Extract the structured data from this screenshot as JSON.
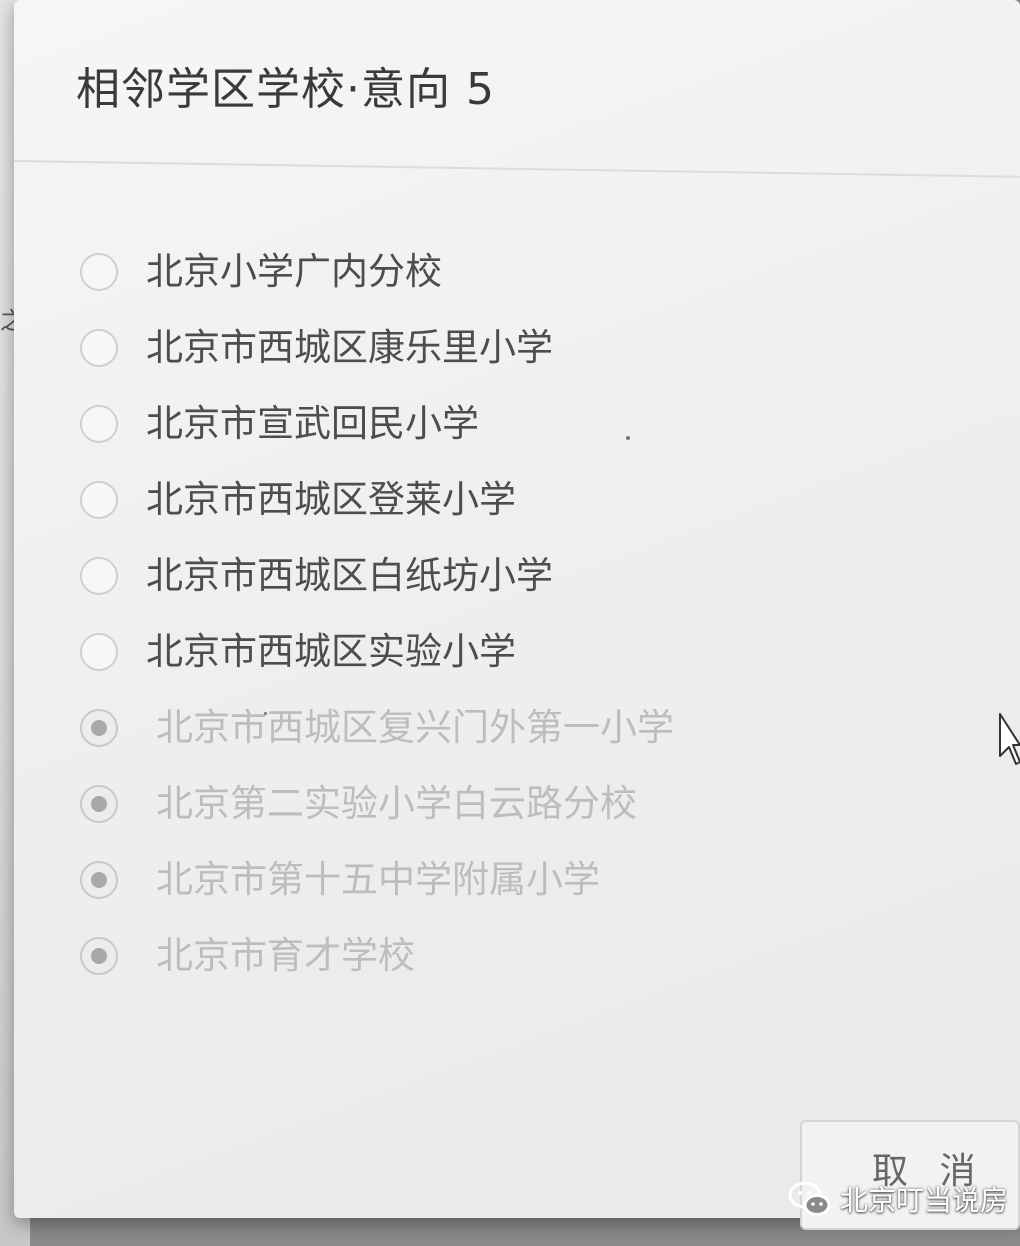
{
  "dialog": {
    "title": "相邻学区学校·意向 5",
    "options": [
      {
        "label": "北京小学广内分校",
        "checked": false,
        "disabled": false
      },
      {
        "label": "北京市西城区康乐里小学",
        "checked": false,
        "disabled": false
      },
      {
        "label": "北京市宣武回民小学",
        "checked": false,
        "disabled": false
      },
      {
        "label": "北京市西城区登莱小学",
        "checked": false,
        "disabled": false
      },
      {
        "label": "北京市西城区白纸坊小学",
        "checked": false,
        "disabled": false
      },
      {
        "label": "北京市西城区实验小学",
        "checked": false,
        "disabled": false
      },
      {
        "label": "北京市西城区复兴门外第一小学",
        "checked": true,
        "disabled": true
      },
      {
        "label": "北京第二实验小学白云路分校",
        "checked": true,
        "disabled": true
      },
      {
        "label": "北京市第十五中学附属小学",
        "checked": true,
        "disabled": true
      },
      {
        "label": "北京市育才学校",
        "checked": true,
        "disabled": true
      }
    ],
    "cancel_label": "取 消"
  },
  "backdrop": {
    "edge_text": "之"
  },
  "watermark": {
    "icon": "wechat-icon",
    "text": "北京叮当说房"
  },
  "colors": {
    "dialog_background": "#f2f2f1",
    "text_enabled": "#4d4d4d",
    "text_disabled": "#bdbdbc",
    "radio_dot": "#a9a9a8"
  }
}
